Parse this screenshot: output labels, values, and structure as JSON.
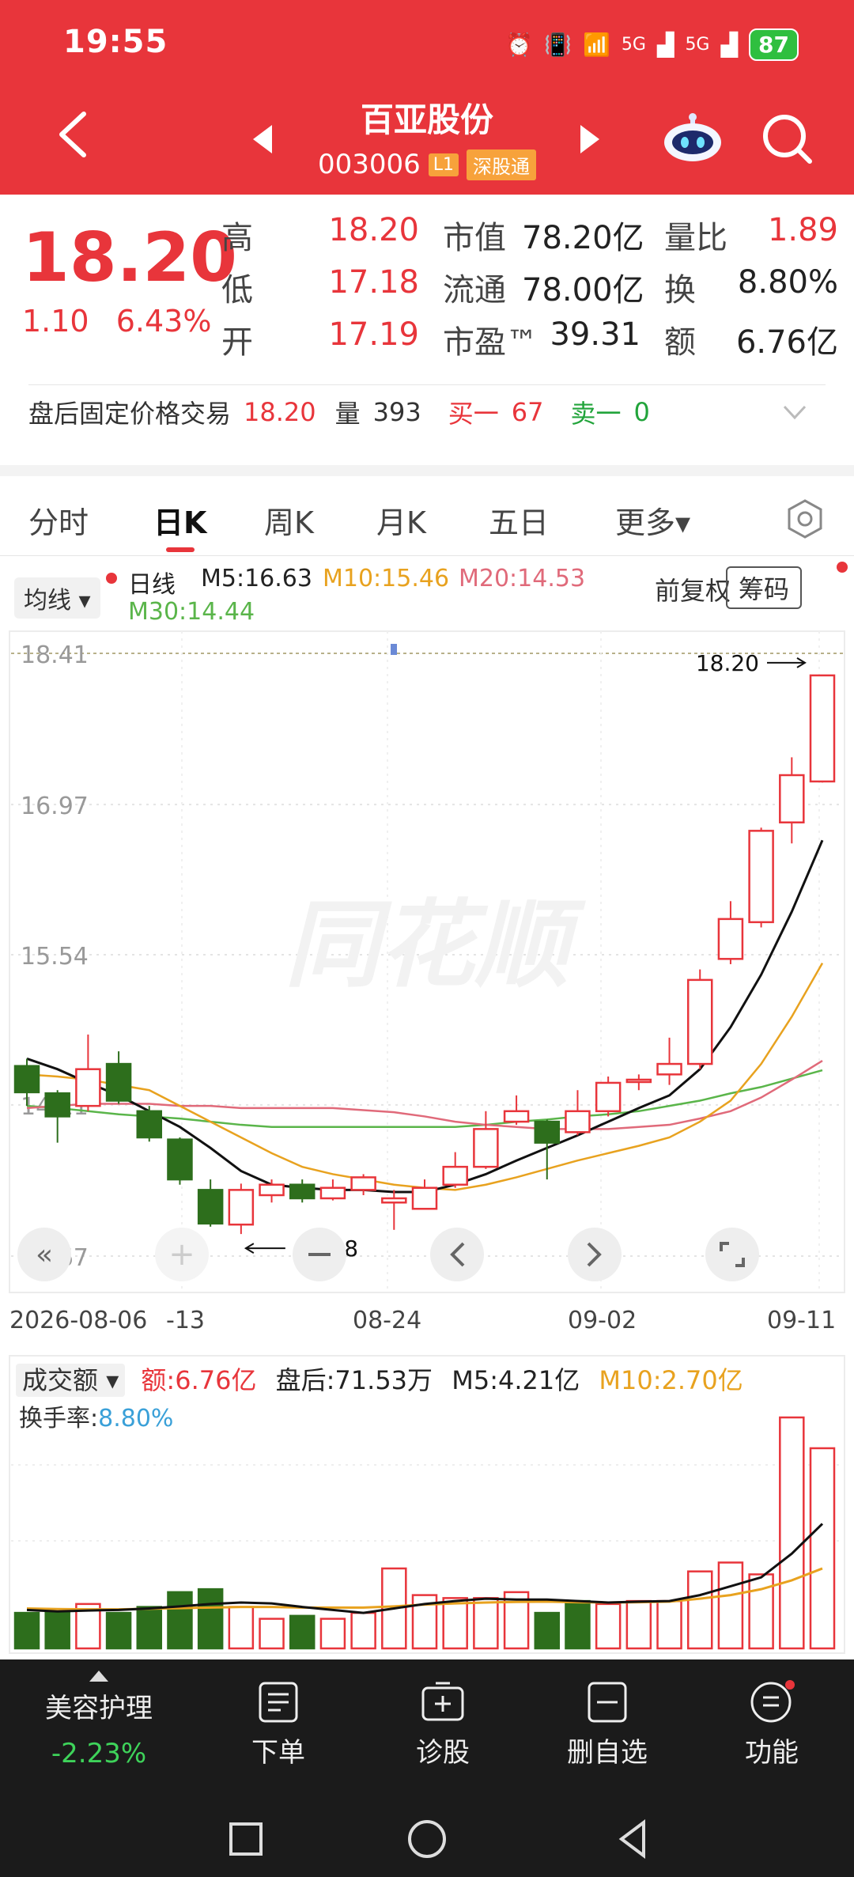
{
  "status": {
    "time": "19:55",
    "battery": "87",
    "signal_labels": [
      "5G",
      "5G"
    ]
  },
  "header": {
    "title": "百亚股份",
    "code": "003006",
    "level_tag": "L1",
    "market_tag": "深股通"
  },
  "quote": {
    "price": "18.20",
    "change": "1.10",
    "change_pct": "6.43%",
    "rows": [
      [
        {
          "label": "高",
          "value": "18.20"
        },
        {
          "label": "市值",
          "value": "78.20亿"
        },
        {
          "label": "量比",
          "value": "1.89"
        }
      ],
      [
        {
          "label": "低",
          "value": "17.18"
        },
        {
          "label": "流通",
          "value": "78.00亿"
        },
        {
          "label": "换",
          "value": "8.80%"
        }
      ],
      [
        {
          "label": "开",
          "value": "17.19"
        },
        {
          "label": "市盈™",
          "value": "39.31"
        },
        {
          "label": "额",
          "value": "6.76亿"
        }
      ]
    ]
  },
  "after_hours": {
    "label": "盘后固定价格交易",
    "price": "18.20",
    "vol_label": "量",
    "vol": "393",
    "buy_label": "买一",
    "buy": "67",
    "sell_label": "卖一",
    "sell": "0"
  },
  "tabs": [
    "分时",
    "日K",
    "周K",
    "月K",
    "五日",
    "更多▾"
  ],
  "legend": {
    "ma_button": "均线",
    "period": "日线",
    "m5": "M5:16.63",
    "m10": "M10:15.46",
    "m20": "M20:14.53",
    "m30": "M30:14.44",
    "fuquan": "前复权",
    "chouma": "筹码"
  },
  "colors": {
    "up": "#e8353b",
    "down": "#2d6e1c",
    "m5": "#111111",
    "m10": "#e8a21f",
    "m20": "#e06a7a",
    "m30": "#5ab54a",
    "turnover": "#3aa0d8"
  },
  "chart_data": {
    "type": "candlestick",
    "y_ticks": [
      "18.41",
      "16.97",
      "15.54",
      "14.11",
      "12.67"
    ],
    "ylim": [
      12.67,
      18.41
    ],
    "x_tick_labels": [
      "2026-08-06",
      "-13",
      "08-24",
      "09-02",
      "09-11"
    ],
    "annotations": {
      "high": "18.20",
      "low": "12.88"
    },
    "candles": [
      {
        "o": 14.48,
        "c": 14.23,
        "h": 14.55,
        "l": 14.1
      },
      {
        "o": 14.22,
        "c": 14.0,
        "h": 14.25,
        "l": 13.75
      },
      {
        "o": 14.1,
        "c": 14.45,
        "h": 14.78,
        "l": 14.05
      },
      {
        "o": 14.5,
        "c": 14.15,
        "h": 14.62,
        "l": 14.12
      },
      {
        "o": 14.05,
        "c": 13.8,
        "h": 14.1,
        "l": 13.76
      },
      {
        "o": 13.78,
        "c": 13.4,
        "h": 13.8,
        "l": 13.35
      },
      {
        "o": 13.3,
        "c": 12.98,
        "h": 13.4,
        "l": 12.95
      },
      {
        "o": 12.97,
        "c": 13.3,
        "h": 13.36,
        "l": 12.88
      },
      {
        "o": 13.25,
        "c": 13.35,
        "h": 13.4,
        "l": 13.18
      },
      {
        "o": 13.35,
        "c": 13.22,
        "h": 13.4,
        "l": 13.18
      },
      {
        "o": 13.22,
        "c": 13.32,
        "h": 13.4,
        "l": 13.2
      },
      {
        "o": 13.3,
        "c": 13.42,
        "h": 13.45,
        "l": 13.25
      },
      {
        "o": 13.18,
        "c": 13.22,
        "h": 13.3,
        "l": 12.92
      },
      {
        "o": 13.12,
        "c": 13.32,
        "h": 13.4,
        "l": 13.12
      },
      {
        "o": 13.35,
        "c": 13.52,
        "h": 13.66,
        "l": 13.32
      },
      {
        "o": 13.52,
        "c": 13.88,
        "h": 14.05,
        "l": 13.5
      },
      {
        "o": 13.95,
        "c": 14.05,
        "h": 14.2,
        "l": 13.92
      },
      {
        "o": 13.95,
        "c": 13.75,
        "h": 13.97,
        "l": 13.4
      },
      {
        "o": 13.85,
        "c": 14.05,
        "h": 14.25,
        "l": 13.82
      },
      {
        "o": 14.05,
        "c": 14.32,
        "h": 14.38,
        "l": 14.0
      },
      {
        "o": 14.35,
        "c": 14.35,
        "h": 14.4,
        "l": 14.25
      },
      {
        "o": 14.4,
        "c": 14.5,
        "h": 14.75,
        "l": 14.3
      },
      {
        "o": 14.5,
        "c": 15.3,
        "h": 15.4,
        "l": 14.45
      },
      {
        "o": 15.5,
        "c": 15.88,
        "h": 16.05,
        "l": 15.45
      },
      {
        "o": 15.85,
        "c": 16.72,
        "h": 16.75,
        "l": 15.8
      },
      {
        "o": 16.8,
        "c": 17.25,
        "h": 17.42,
        "l": 16.6
      },
      {
        "o": 17.19,
        "c": 18.2,
        "h": 18.2,
        "l": 17.18
      }
    ],
    "ma": {
      "m5": [
        14.55,
        14.45,
        14.32,
        14.2,
        14.05,
        13.9,
        13.7,
        13.48,
        13.35,
        13.32,
        13.3,
        13.3,
        13.28,
        13.28,
        13.35,
        13.45,
        13.58,
        13.7,
        13.82,
        13.95,
        14.08,
        14.2,
        14.45,
        14.85,
        15.35,
        15.95,
        16.63
      ],
      "m10": [
        14.4,
        14.38,
        14.35,
        14.3,
        14.25,
        14.1,
        13.95,
        13.8,
        13.65,
        13.52,
        13.45,
        13.4,
        13.35,
        13.32,
        13.3,
        13.35,
        13.42,
        13.5,
        13.58,
        13.65,
        13.72,
        13.8,
        13.95,
        14.15,
        14.5,
        14.95,
        15.46
      ],
      "m20": [
        14.08,
        14.1,
        14.12,
        14.12,
        14.12,
        14.1,
        14.1,
        14.08,
        14.08,
        14.08,
        14.08,
        14.06,
        14.04,
        14.0,
        13.95,
        13.92,
        13.9,
        13.88,
        13.88,
        13.88,
        13.9,
        13.92,
        13.98,
        14.05,
        14.18,
        14.35,
        14.53
      ],
      "m30": [
        14.1,
        14.08,
        14.05,
        14.02,
        14.0,
        13.98,
        13.95,
        13.92,
        13.9,
        13.9,
        13.9,
        13.9,
        13.9,
        13.9,
        13.9,
        13.92,
        13.95,
        13.97,
        14.0,
        14.02,
        14.05,
        14.1,
        14.15,
        14.22,
        14.28,
        14.36,
        14.44
      ]
    },
    "volume": {
      "values": [
        1.2,
        1.2,
        1.5,
        1.2,
        1.4,
        1.9,
        2.0,
        1.4,
        1.0,
        1.1,
        1.0,
        1.2,
        2.7,
        1.8,
        1.7,
        1.7,
        1.9,
        1.2,
        1.6,
        1.5,
        1.6,
        1.6,
        2.6,
        2.9,
        2.5,
        7.8,
        6.76
      ],
      "up": [
        false,
        false,
        true,
        false,
        false,
        false,
        false,
        true,
        true,
        false,
        true,
        true,
        true,
        true,
        true,
        true,
        true,
        false,
        false,
        true,
        true,
        true,
        true,
        true,
        true,
        true,
        true
      ],
      "ma5": [
        1.3,
        1.25,
        1.28,
        1.3,
        1.35,
        1.42,
        1.5,
        1.55,
        1.52,
        1.4,
        1.3,
        1.2,
        1.35,
        1.5,
        1.6,
        1.68,
        1.65,
        1.65,
        1.6,
        1.55,
        1.58,
        1.6,
        1.8,
        2.1,
        2.4,
        3.2,
        4.21
      ],
      "ma10": [
        1.35,
        1.33,
        1.32,
        1.32,
        1.34,
        1.36,
        1.38,
        1.4,
        1.4,
        1.38,
        1.38,
        1.38,
        1.42,
        1.48,
        1.52,
        1.55,
        1.57,
        1.58,
        1.56,
        1.55,
        1.56,
        1.58,
        1.68,
        1.8,
        2.0,
        2.3,
        2.7
      ],
      "ylim": [
        0,
        7.8
      ]
    }
  },
  "volume_legend": {
    "button": "成交额",
    "amount": "额:6.76亿",
    "after": "盘后:71.53万",
    "m5": "M5:4.21亿",
    "m10": "M10:2.70亿",
    "turnover_label": "换手率:",
    "turnover": "8.80%"
  },
  "bottom_bar": {
    "sector_name": "美容护理",
    "sector_change": "-2.23%",
    "items": [
      "下单",
      "诊股",
      "删自选",
      "功能"
    ]
  }
}
